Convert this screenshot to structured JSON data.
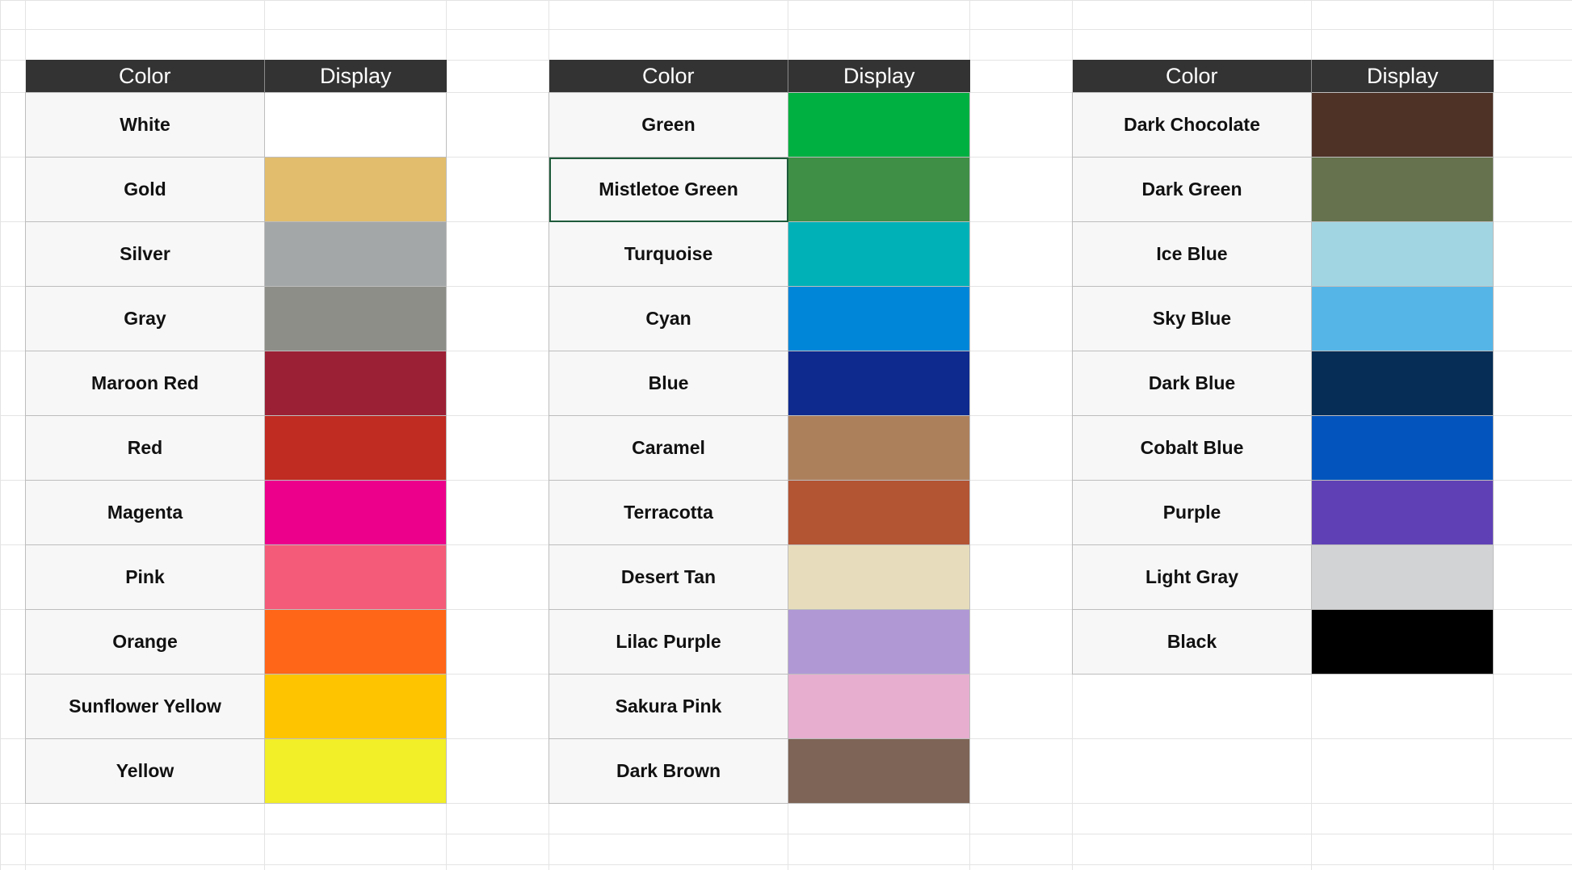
{
  "header": {
    "color_label": "Color",
    "display_label": "Display"
  },
  "tables": [
    {
      "rows": [
        {
          "name": "White",
          "hex": "#ffffff"
        },
        {
          "name": "Gold",
          "hex": "#e2bd6d"
        },
        {
          "name": "Silver",
          "hex": "#a4a7a8"
        },
        {
          "name": "Gray",
          "hex": "#8e8e89"
        },
        {
          "name": "Maroon Red",
          "hex": "#9b2035"
        },
        {
          "name": "Red",
          "hex": "#c02b22"
        },
        {
          "name": "Magenta",
          "hex": "#ec008b"
        },
        {
          "name": "Pink",
          "hex": "#f45b78"
        },
        {
          "name": "Orange",
          "hex": "#ff6617"
        },
        {
          "name": "Sunflower Yellow",
          "hex": "#fec400"
        },
        {
          "name": "Yellow",
          "hex": "#f2ee27"
        }
      ]
    },
    {
      "rows": [
        {
          "name": "Green",
          "hex": "#00b040"
        },
        {
          "name": "Mistletoe Green",
          "hex": "#408f46",
          "selected": true
        },
        {
          "name": "Turquoise",
          "hex": "#00b2b8"
        },
        {
          "name": "Cyan",
          "hex": "#0086d9"
        },
        {
          "name": "Blue",
          "hex": "#0e2a8e"
        },
        {
          "name": "Caramel",
          "hex": "#ad805c"
        },
        {
          "name": "Terracotta",
          "hex": "#b35433"
        },
        {
          "name": "Desert Tan",
          "hex": "#e7ddbc"
        },
        {
          "name": "Lilac Purple",
          "hex": "#b098d5"
        },
        {
          "name": "Sakura Pink",
          "hex": "#e7aed0"
        },
        {
          "name": "Dark Brown",
          "hex": "#7d6456"
        }
      ]
    },
    {
      "rows": [
        {
          "name": "Dark Chocolate",
          "hex": "#4e3226"
        },
        {
          "name": "Dark Green",
          "hex": "#65724d"
        },
        {
          "name": "Ice Blue",
          "hex": "#a2d5e2"
        },
        {
          "name": "Sky Blue",
          "hex": "#56b5e7"
        },
        {
          "name": "Dark Blue",
          "hex": "#052d55"
        },
        {
          "name": "Cobalt Blue",
          "hex": "#0454bd"
        },
        {
          "name": "Purple",
          "hex": "#6041b5"
        },
        {
          "name": "Light Gray",
          "hex": "#d2d3d5"
        },
        {
          "name": "Black",
          "hex": "#000000"
        }
      ]
    }
  ]
}
